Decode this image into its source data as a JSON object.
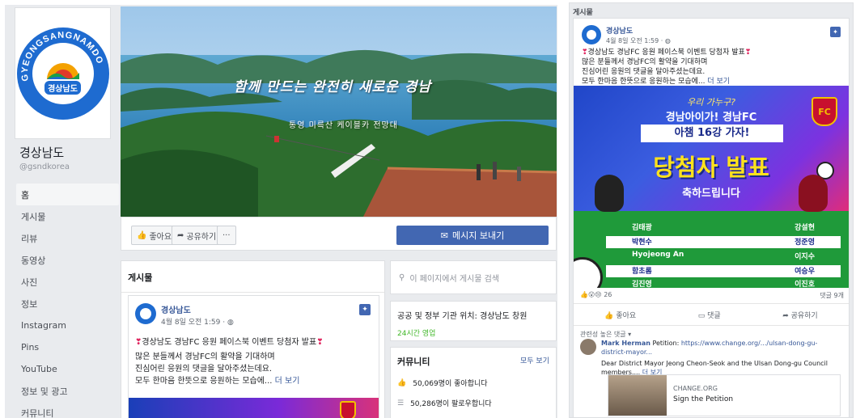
{
  "page": {
    "name": "경상남도",
    "handle": "@gsndkorea",
    "logo_ring_text": "GYEONGSANGNAMDO",
    "logo_inner_text": "경상남도"
  },
  "sidebar": {
    "items": [
      {
        "label": "홈",
        "active": true
      },
      {
        "label": "게시물"
      },
      {
        "label": "리뷰"
      },
      {
        "label": "동영상"
      },
      {
        "label": "사진"
      },
      {
        "label": "정보"
      },
      {
        "label": "Instagram"
      },
      {
        "label": "Pins"
      },
      {
        "label": "YouTube"
      },
      {
        "label": "정보 및 광고"
      },
      {
        "label": "커뮤니티"
      }
    ]
  },
  "cover": {
    "title": "함께 만드는 완전히 새로운 경남",
    "subtitle": "통영 미륵산 케이블카 전망대"
  },
  "actions": {
    "like": "좋아요",
    "share": "공유하기",
    "more": "···",
    "message": "메시지 보내기"
  },
  "posts": {
    "heading": "게시물",
    "card": {
      "author": "경상남도",
      "time": "4월 8일 오전 1:59 · ",
      "title": "경상남도 경남FC 응원 페이스북 이벤트 당첨자 발표",
      "line1": "많은 분들께서 경남FC의 활약을 기대하며",
      "line2": "진심어린 응원의 댓글을 달아주셨는데요.",
      "line3": "모두 한마음 한뜻으로 응원하는 모습에...",
      "more": "더 보기"
    }
  },
  "right_col": {
    "search_placeholder": "이 페이지에서 게시물 검색",
    "info_line": "공공 및 정부 기관 위치: 경상남도 창원",
    "hours": "24시간 영업",
    "community_heading": "커뮤니티",
    "community_all": "모두 보기",
    "likes": "50,069명이 좋아합니다",
    "follows": "50,286명이 팔로우합니다"
  },
  "zoom_post": {
    "section": "게시물",
    "author": "경상남도",
    "time": "4월 8일 오전 1:59 · ",
    "title": "경상남도 경남FC 응원 페이스북 이벤트 당첨자 발표",
    "line1": "많은 분들께서 경남FC의 활약을 기대하며",
    "line2": "진심어린 응원의 댓글을 달아주셨는데요.",
    "line3": "모두 한마음 한뜻으로 응원하는 모습에...",
    "more": "더 보기",
    "promo": {
      "question": "우리 가누구?",
      "line1": "경남아이가! 경남FC",
      "line2": "아챔 16강 가자!",
      "big": "당첨자 발표",
      "congrats": "축하드립니다",
      "logo": "FC",
      "winners": [
        [
          "김태광",
          "강설현"
        ],
        [
          "박현수",
          "정준영"
        ],
        [
          "Hyojeong An",
          "이지수"
        ],
        [
          "함초롬",
          "여승우"
        ],
        [
          "김진영",
          "이진호"
        ]
      ]
    },
    "reactions_count": "26",
    "comments_count": "댓글 9개",
    "like": "좋아요",
    "comment": "댓글",
    "share": "공유하기",
    "sort": "관련성 높은 댓글 ▾",
    "comment_author": "Mark Herman",
    "comment_text": "Petition:",
    "comment_link": "https://www.change.org/.../ulsan-dong-gu-district-mayor...",
    "comment_line2": "Dear District Mayor Jeong Cheon-Seok and the Ulsan Dong-gu Council members.... ",
    "comment_more": "더 보기",
    "preview_site": "CHANGE.ORG",
    "preview_title": "Sign the Petition",
    "comment_age": "6일"
  },
  "colors": {
    "brand_blue": "#4267b2",
    "link": "#385898",
    "bg": "#e9ebee",
    "green_hours": "#42b72a"
  }
}
